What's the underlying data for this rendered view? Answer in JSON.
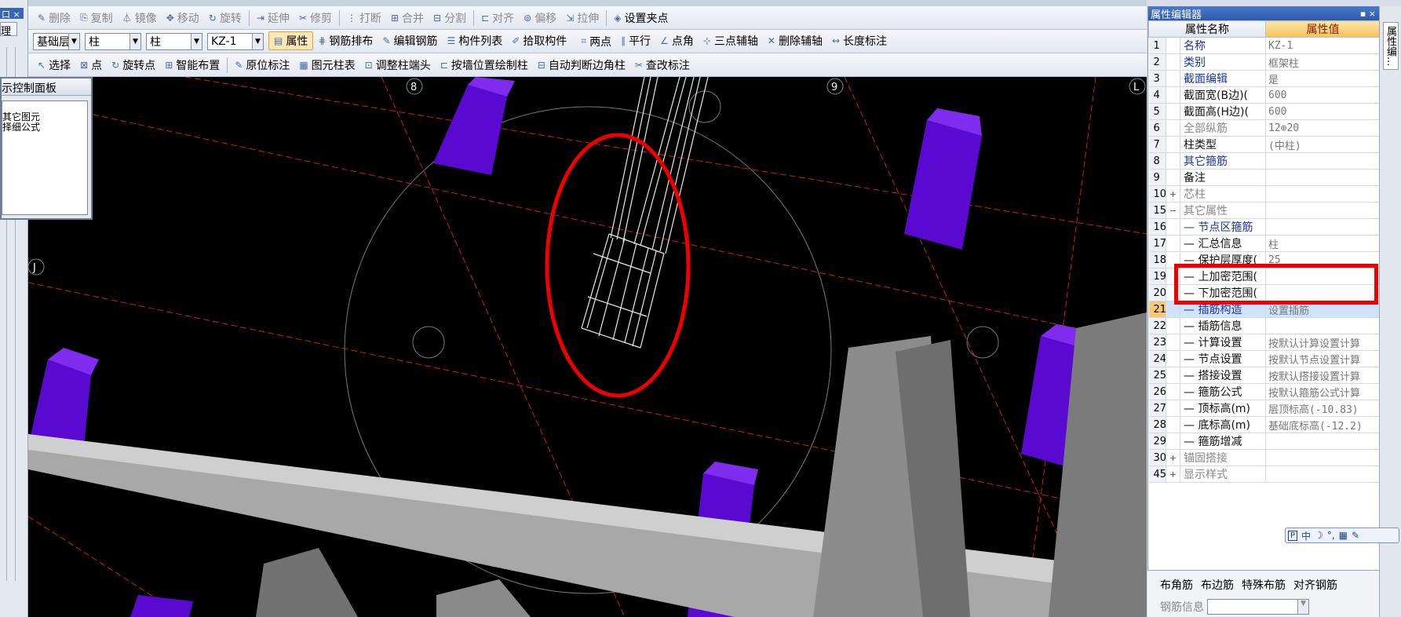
{
  "control_panel": {
    "title": "示控制面板",
    "lines": [
      "其它图元",
      "择细公式"
    ]
  },
  "left_strip": {
    "title": "口 ×",
    "tab": "理"
  },
  "toolbar1": {
    "items": [
      {
        "label": "删除",
        "icon": "delete-icon"
      },
      {
        "label": "复制",
        "icon": "copy-icon"
      },
      {
        "label": "镜像",
        "icon": "mirror-icon"
      },
      {
        "label": "移动",
        "icon": "move-icon"
      },
      {
        "label": "旋转",
        "icon": "rotate-icon"
      },
      {
        "label": "延伸",
        "icon": "extend-icon"
      },
      {
        "label": "修剪",
        "icon": "trim-icon"
      },
      {
        "label": "打断",
        "icon": "break-icon"
      },
      {
        "label": "合并",
        "icon": "merge-icon"
      },
      {
        "label": "分割",
        "icon": "split-icon"
      },
      {
        "label": "对齐",
        "icon": "align-icon"
      },
      {
        "label": "偏移",
        "icon": "offset-icon"
      },
      {
        "label": "拉伸",
        "icon": "stretch-icon"
      },
      {
        "label": "设置夹点",
        "icon": "grip-icon"
      }
    ]
  },
  "toolbar2": {
    "floor_select": "基础层",
    "type_select": "柱",
    "subtype_select": "柱",
    "component_select": "KZ-1",
    "items": [
      {
        "label": "属性",
        "icon": "property-icon"
      },
      {
        "label": "钢筋排布",
        "icon": "rebar-layout-icon"
      },
      {
        "label": "编辑钢筋",
        "icon": "edit-rebar-icon"
      },
      {
        "label": "构件列表",
        "icon": "list-icon"
      },
      {
        "label": "拾取构件",
        "icon": "pick-icon"
      },
      {
        "label": "两点",
        "icon": "two-point-icon"
      },
      {
        "label": "平行",
        "icon": "parallel-icon"
      },
      {
        "label": "点角",
        "icon": "point-angle-icon"
      },
      {
        "label": "三点辅轴",
        "icon": "three-point-axis-icon"
      },
      {
        "label": "删除辅轴",
        "icon": "delete-axis-icon"
      },
      {
        "label": "长度标注",
        "icon": "length-dimension-icon"
      }
    ]
  },
  "toolbar3": {
    "items": [
      {
        "label": "选择",
        "icon": "select-icon"
      },
      {
        "label": "点",
        "icon": "point-icon"
      },
      {
        "label": "旋转点",
        "icon": "rotate-point-icon"
      },
      {
        "label": "智能布置",
        "icon": "smart-layout-icon"
      },
      {
        "label": "原位标注",
        "icon": "in-place-label-icon"
      },
      {
        "label": "图元柱表",
        "icon": "column-table-icon"
      },
      {
        "label": "调整柱端头",
        "icon": "adjust-column-end-icon"
      },
      {
        "label": "按墙位置绘制柱",
        "icon": "wall-column-icon"
      },
      {
        "label": "自动判断边角柱",
        "icon": "auto-corner-column-icon"
      },
      {
        "label": "查改标注",
        "icon": "check-label-icon"
      }
    ]
  },
  "viewport": {
    "axis_labels": [
      "8",
      "9",
      "J",
      "L"
    ],
    "background": "#000000",
    "column_color": "#6a0fe0",
    "wall_color": "#9a9a9a",
    "annotation_color": "#ef0000"
  },
  "property_editor": {
    "title": "属性编辑器",
    "title_controls": "▪ ×",
    "header_name": "属性名称",
    "header_value": "属性值",
    "rows": [
      {
        "num": "1",
        "exp": "",
        "name": "名称",
        "value": "KZ-1",
        "style": "blue"
      },
      {
        "num": "2",
        "exp": "",
        "name": "类别",
        "value": "框架柱",
        "style": "blue"
      },
      {
        "num": "3",
        "exp": "",
        "name": "截面编辑",
        "value": "是",
        "style": "blue"
      },
      {
        "num": "4",
        "exp": "",
        "name": "截面宽(B边)(",
        "value": "600",
        "style": "black"
      },
      {
        "num": "5",
        "exp": "",
        "name": "截面高(H边)(",
        "value": "600",
        "style": "black"
      },
      {
        "num": "6",
        "exp": "",
        "name": "全部纵筋",
        "value": "12⊕20",
        "style": "gray"
      },
      {
        "num": "7",
        "exp": "",
        "name": "柱类型",
        "value": "(中柱)",
        "style": "black"
      },
      {
        "num": "8",
        "exp": "",
        "name": "其它箍筋",
        "value": "",
        "style": "blue"
      },
      {
        "num": "9",
        "exp": "",
        "name": "备注",
        "value": "",
        "style": "black"
      },
      {
        "num": "10",
        "exp": "+",
        "name": "芯柱",
        "value": "",
        "style": "gray"
      },
      {
        "num": "15",
        "exp": "−",
        "name": "其它属性",
        "value": "",
        "style": "gray"
      },
      {
        "num": "16",
        "exp": "",
        "name": "— 节点区箍筋",
        "value": "",
        "style": "blue"
      },
      {
        "num": "17",
        "exp": "",
        "name": "— 汇总信息",
        "value": "柱",
        "style": "black"
      },
      {
        "num": "18",
        "exp": "",
        "name": "— 保护层厚度(",
        "value": "25",
        "style": "black"
      },
      {
        "num": "19",
        "exp": "",
        "name": "— 上加密范围(",
        "value": "",
        "style": "black"
      },
      {
        "num": "20",
        "exp": "",
        "name": "— 下加密范围(",
        "value": "",
        "style": "black"
      },
      {
        "num": "21",
        "exp": "",
        "name": "— 插筋构造",
        "value": "设置插筋",
        "style": "blue",
        "selected": true
      },
      {
        "num": "22",
        "exp": "",
        "name": "— 插筋信息",
        "value": "",
        "style": "black"
      },
      {
        "num": "23",
        "exp": "",
        "name": "— 计算设置",
        "value": "按默认计算设置计算",
        "style": "black"
      },
      {
        "num": "24",
        "exp": "",
        "name": "— 节点设置",
        "value": "按默认节点设置计算",
        "style": "black"
      },
      {
        "num": "25",
        "exp": "",
        "name": "— 搭接设置",
        "value": "按默认搭接设置计算",
        "style": "black"
      },
      {
        "num": "26",
        "exp": "",
        "name": "— 箍筋公式",
        "value": "按默认箍筋公式计算",
        "style": "black"
      },
      {
        "num": "27",
        "exp": "",
        "name": "— 顶标高(m)",
        "value": "层顶标高(-10.83)",
        "style": "black"
      },
      {
        "num": "28",
        "exp": "",
        "name": "— 底标高(m)",
        "value": "基础底标高(-12.2)",
        "style": "black"
      },
      {
        "num": "29",
        "exp": "",
        "name": "— 箍筋增减",
        "value": "",
        "style": "black"
      },
      {
        "num": "30",
        "exp": "+",
        "name": "锚固搭接",
        "value": "",
        "style": "gray"
      },
      {
        "num": "45",
        "exp": "+",
        "name": "显示样式",
        "value": "",
        "style": "gray"
      }
    ]
  },
  "side_tab": {
    "label": "属性编..."
  },
  "ime_bar": {
    "items": [
      "中",
      "☽",
      "°,",
      "▦",
      "✎"
    ]
  },
  "rebar_panel": {
    "tabs": [
      "布角筋",
      "布边筋",
      "特殊布筋",
      "对齐钢筋"
    ],
    "info_label": "钢筋信息"
  }
}
